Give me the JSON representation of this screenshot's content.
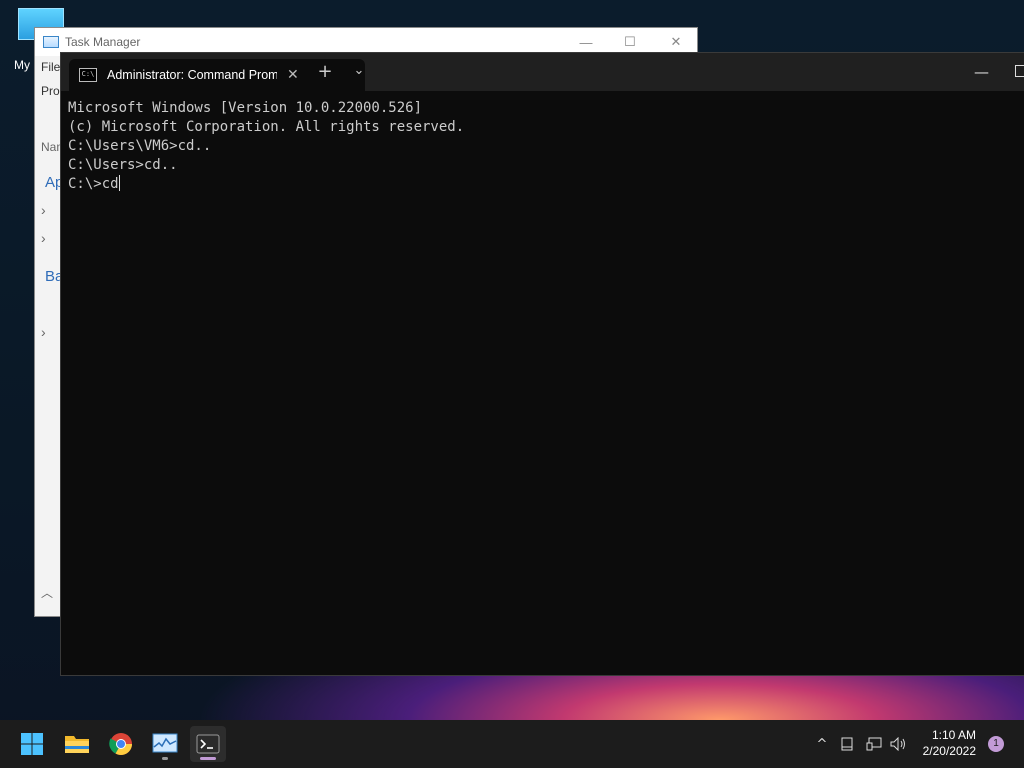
{
  "desktop": {
    "icon_label": "My Co"
  },
  "task_manager": {
    "title": "Task Manager",
    "menu_file": "File",
    "tab_processes": "Pro",
    "col_name": "Nam",
    "section_apps": "Ap",
    "section_background": "Ba",
    "minimize": "—",
    "maximize": "☐",
    "close": "✕"
  },
  "terminal": {
    "tab_title": "Administrator: Command Prompt",
    "tab_icon_text": "C:\\",
    "new_tab": "+",
    "dropdown": "⌄",
    "minimize": "—",
    "lines": [
      "Microsoft Windows [Version 10.0.22000.526]",
      "(c) Microsoft Corporation. All rights reserved.",
      "",
      "C:\\Users\\VM6>cd..",
      "",
      "C:\\Users>cd..",
      "",
      "C:\\>cd"
    ]
  },
  "taskbar": {
    "apps": [
      "start-icon",
      "file-explorer-icon",
      "chrome-icon",
      "task-manager-icon",
      "terminal-icon"
    ],
    "time": "1:10 AM",
    "date": "2/20/2022",
    "notification_count": "1",
    "accent_underline": "#c29bd6",
    "tray_chevron": "^"
  }
}
